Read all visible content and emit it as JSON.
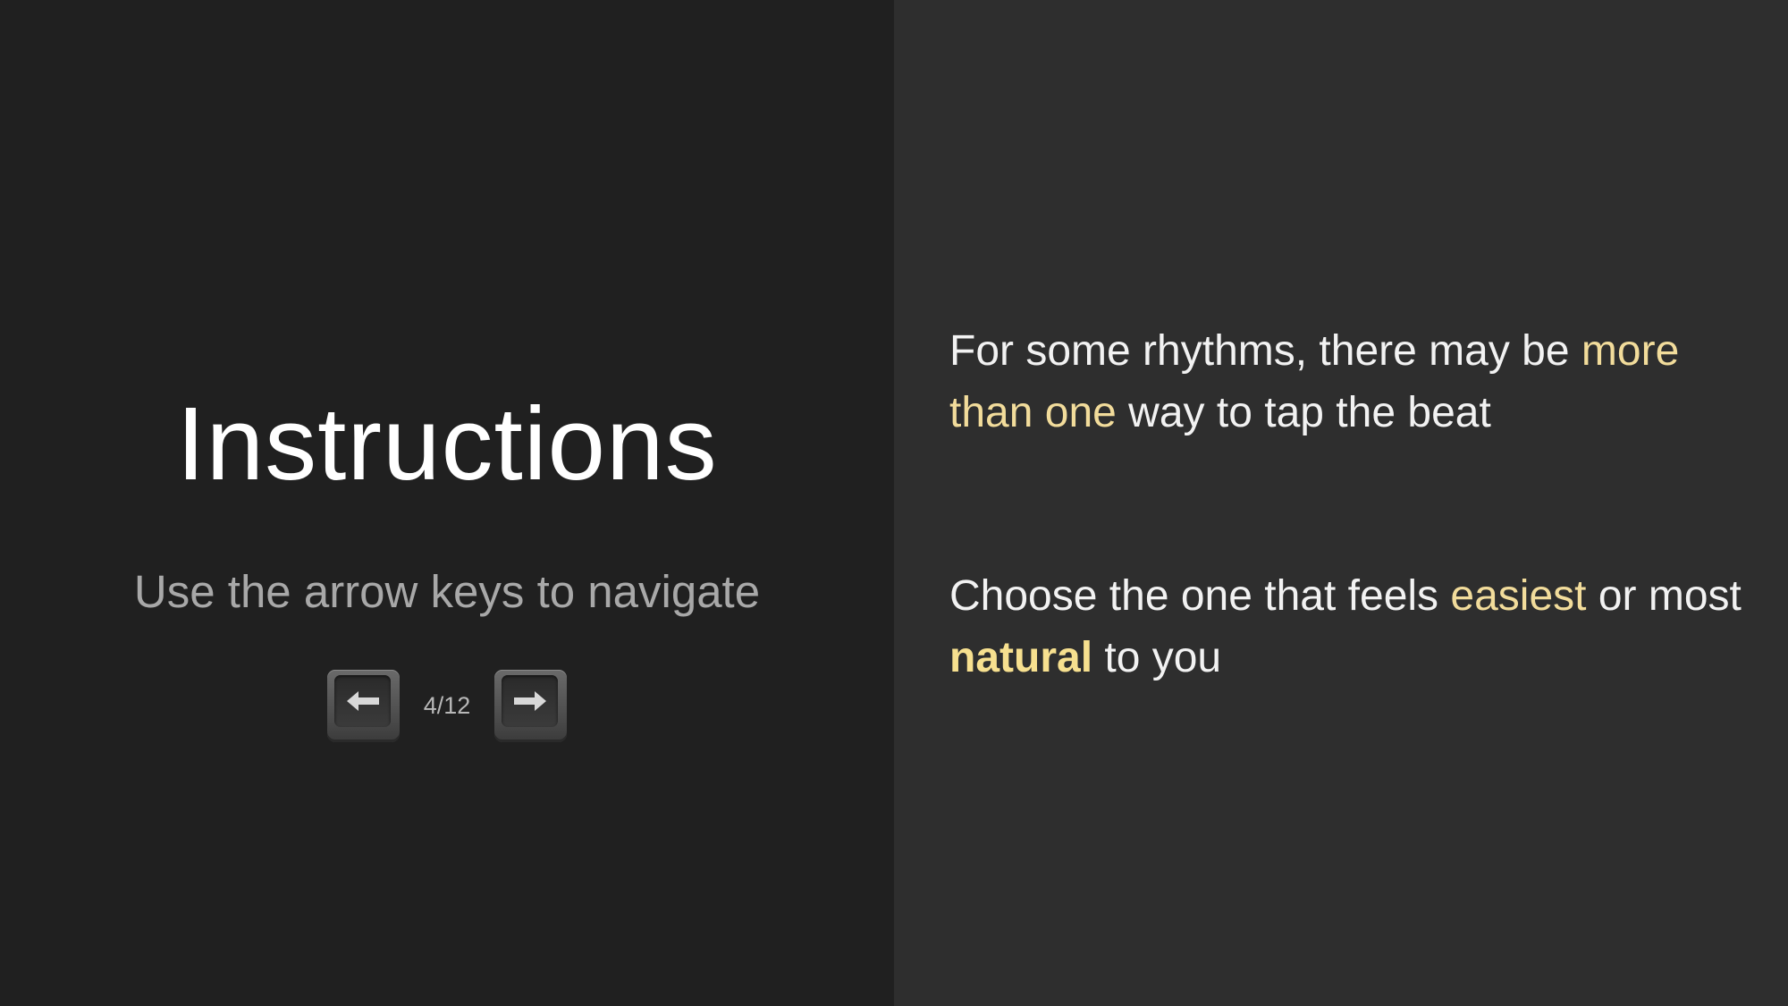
{
  "left": {
    "title": "Instructions",
    "subtitle": "Use the arrow keys to navigate",
    "nav": {
      "prev_icon": "left-arrow-key-icon",
      "next_icon": "right-arrow-key-icon",
      "page_indicator": "4/12"
    }
  },
  "right": {
    "paragraph1": {
      "part1": "For some rhythms, there may be ",
      "highlight1": "more than one",
      "part2": " way to tap the beat"
    },
    "paragraph2": {
      "part1": "Choose the one that feels ",
      "highlight1": "easiest",
      "part2": " or most ",
      "highlight2": "natural",
      "part3": " to you"
    }
  },
  "colors": {
    "left_background": "#202020",
    "right_background": "#2e2e2e",
    "highlight": "#f2dc9b",
    "text": "#f2f2f2",
    "subtitle": "#a8a8a8"
  }
}
